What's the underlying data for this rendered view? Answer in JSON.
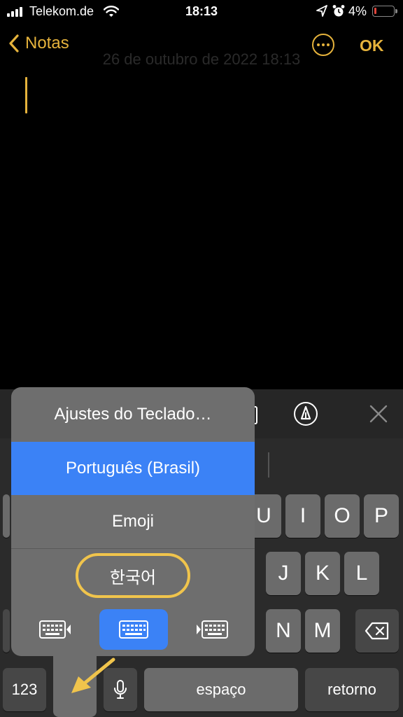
{
  "status_bar": {
    "carrier": "Telekom.de",
    "time": "18:13",
    "battery_percent": "4%",
    "battery_level": 0.04,
    "signal_icon": "signal-bars-icon",
    "wifi_icon": "wifi-icon",
    "location_icon": "location-arrow-icon",
    "alarm_icon": "alarm-clock-icon"
  },
  "nav": {
    "back_label": "Notas",
    "more_icon": "ellipsis-circle-icon",
    "done_label": "OK",
    "accent_color": "#E6B33C"
  },
  "note": {
    "date_text": "26 de outubro de 2022 18:13"
  },
  "keyboard_menu": {
    "items": [
      {
        "label": "Ajustes do Teclado…",
        "selected": false
      },
      {
        "label": "Português (Brasil)",
        "selected": true
      },
      {
        "label": "Emoji",
        "selected": false
      },
      {
        "label": "한국어",
        "selected": false,
        "highlighted": true
      }
    ],
    "modes": [
      {
        "icon": "keyboard-left-icon",
        "active": false
      },
      {
        "icon": "keyboard-full-icon",
        "active": true
      },
      {
        "icon": "keyboard-right-icon",
        "active": false
      }
    ],
    "selected_color": "#3B82F6",
    "highlight_color": "#F0C44C"
  },
  "keyboard": {
    "row1_visible": [
      "U",
      "I",
      "O",
      "P"
    ],
    "row2_visible": [
      "J",
      "K",
      "L"
    ],
    "row3_visible": [
      "N",
      "M"
    ],
    "numbers_label": "123",
    "space_label": "espaço",
    "return_label": "retorno",
    "mic_icon": "microphone-icon",
    "globe_icon": "globe-icon",
    "backspace_icon": "backspace-icon",
    "markup_icon": "markup-pen-icon",
    "close_icon": "close-icon"
  }
}
